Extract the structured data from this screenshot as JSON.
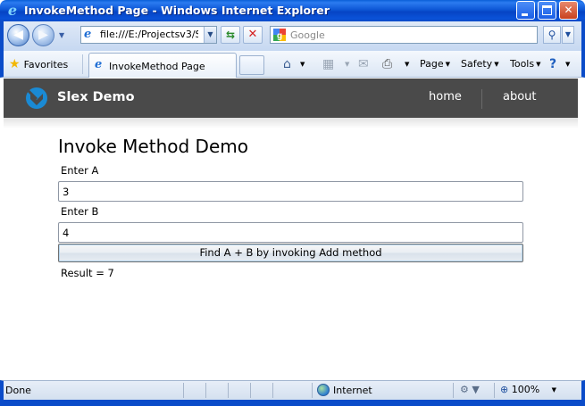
{
  "window": {
    "title": "InvokeMethod Page - Windows Internet Explorer",
    "controls": {
      "minimize": "",
      "maximize": "",
      "close": "✕"
    }
  },
  "navigation": {
    "back_icon": "arrow-left-icon",
    "forward_icon": "arrow-right-icon",
    "address": "file:///E:/Projectsv3/Sl",
    "search_placeholder": "Google",
    "search_go_icon": "magnifier-icon"
  },
  "command_bar": {
    "favorites_label": "Favorites",
    "tab_label": "InvokeMethod Page",
    "menus": {
      "page": "Page",
      "safety": "Safety",
      "tools": "Tools"
    }
  },
  "site": {
    "brand": "Slex Demo",
    "nav": {
      "home": "home",
      "about": "about"
    },
    "accent_color": "#1a8ad4"
  },
  "content": {
    "title": "Invoke Method Demo",
    "label_a": "Enter A",
    "value_a": "3",
    "label_b": "Enter B",
    "value_b": "4",
    "button_label": "Find A + B by invoking Add method",
    "result": "Result = 7"
  },
  "status_bar": {
    "status": "Done",
    "zone": "Internet",
    "zoom": "100%"
  }
}
